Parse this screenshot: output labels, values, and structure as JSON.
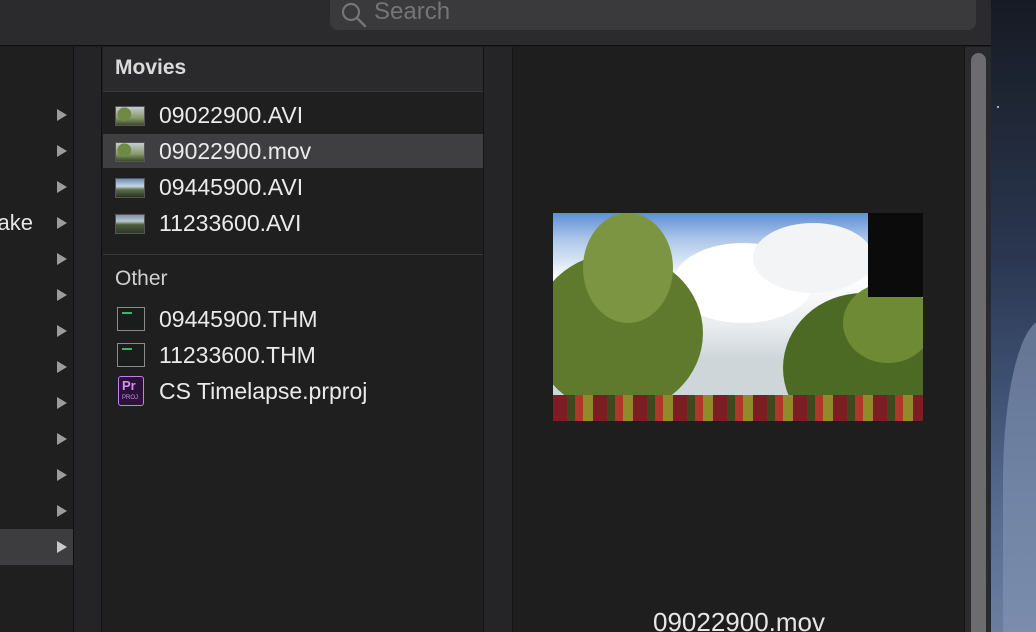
{
  "search": {
    "placeholder": "Search"
  },
  "column1": {
    "rows": [
      {
        "label": ""
      },
      {
        "label": ""
      },
      {
        "label": ""
      },
      {
        "label": "ake"
      },
      {
        "label": ""
      },
      {
        "label": ""
      },
      {
        "label": ""
      },
      {
        "label": ""
      },
      {
        "label": ""
      },
      {
        "label": ""
      },
      {
        "label": ""
      },
      {
        "label": ""
      },
      {
        "label": ""
      }
    ],
    "selected_index": 12
  },
  "column2": {
    "sections": [
      {
        "title": "Movies",
        "items": [
          {
            "name": "09022900.AVI",
            "icon": "movie-thumbnail-icon"
          },
          {
            "name": "09022900.mov",
            "icon": "movie-thumbnail-icon",
            "selected": true
          },
          {
            "name": "09445900.AVI",
            "icon": "movie-thumbnail-icon"
          },
          {
            "name": "11233600.AVI",
            "icon": "movie-thumbnail-icon"
          }
        ]
      },
      {
        "title": "Other",
        "items": [
          {
            "name": "09445900.THM",
            "icon": "terminal-file-icon"
          },
          {
            "name": "11233600.THM",
            "icon": "terminal-file-icon"
          },
          {
            "name": "CS Timelapse.prproj",
            "icon": "premiere-project-icon",
            "icon_text": "Pr",
            "icon_subtext": "PROJ"
          }
        ]
      }
    ]
  },
  "preview": {
    "filename": "09022900.mov"
  },
  "colors": {
    "background": "#1e1e1f",
    "selection": "#3f3f41",
    "premiere": "#c67bf0"
  }
}
